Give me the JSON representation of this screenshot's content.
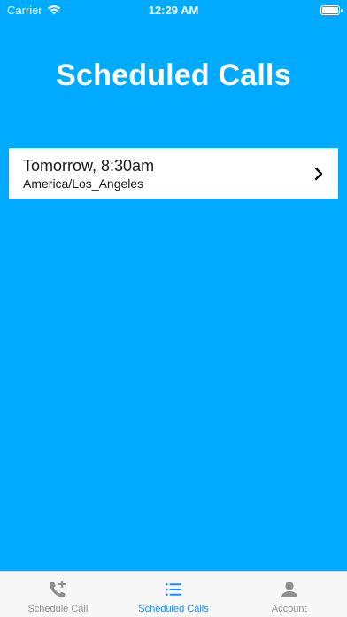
{
  "status": {
    "carrier": "Carrier",
    "time": "12:29 AM"
  },
  "page": {
    "title": "Scheduled Calls"
  },
  "calls": [
    {
      "when": "Tomorrow, 8:30am",
      "timezone": "America/Los_Angeles"
    }
  ],
  "tabs": [
    {
      "label": "Schedule Call",
      "icon": "phone-plus-icon",
      "active": false
    },
    {
      "label": "Scheduled Calls",
      "icon": "list-icon",
      "active": true
    },
    {
      "label": "Account",
      "icon": "person-icon",
      "active": false
    }
  ],
  "colors": {
    "background": "#00aaff",
    "accent": "#1a8cff",
    "tab_inactive": "#8e8e8e"
  }
}
